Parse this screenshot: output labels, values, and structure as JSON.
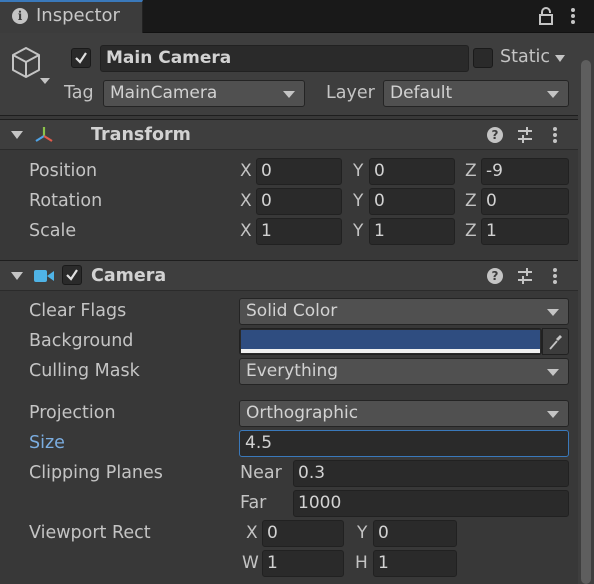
{
  "tab": {
    "title": "Inspector"
  },
  "object": {
    "name": "Main Camera",
    "active": true,
    "static_label": "Static",
    "static": false,
    "tag_label": "Tag",
    "tag": "MainCamera",
    "layer_label": "Layer",
    "layer": "Default"
  },
  "transform": {
    "title": "Transform",
    "rows": [
      {
        "label": "Position",
        "x": "0",
        "y": "0",
        "z": "-9"
      },
      {
        "label": "Rotation",
        "x": "0",
        "y": "0",
        "z": "0"
      },
      {
        "label": "Scale",
        "x": "1",
        "y": "1",
        "z": "1"
      }
    ],
    "axis": {
      "x": "X",
      "y": "Y",
      "z": "Z"
    }
  },
  "camera": {
    "title": "Camera",
    "enabled": true,
    "clear_flags_label": "Clear Flags",
    "clear_flags": "Solid Color",
    "background_label": "Background",
    "background_color": "#2f4d80",
    "culling_mask_label": "Culling Mask",
    "culling_mask": "Everything",
    "projection_label": "Projection",
    "projection": "Orthographic",
    "size_label": "Size",
    "size": "4.5",
    "clipping_label": "Clipping Planes",
    "near_label": "Near",
    "near": "0.3",
    "far_label": "Far",
    "far": "1000",
    "viewport_label": "Viewport Rect",
    "viewport": {
      "x_label": "X",
      "x": "0",
      "y_label": "Y",
      "y": "0",
      "w_label": "W",
      "w": "1",
      "h_label": "H",
      "h": "1"
    }
  },
  "colors": {
    "accent": "#3a79bb",
    "active_label": "#7bade0",
    "camera_icon": "#4fb3e6"
  }
}
